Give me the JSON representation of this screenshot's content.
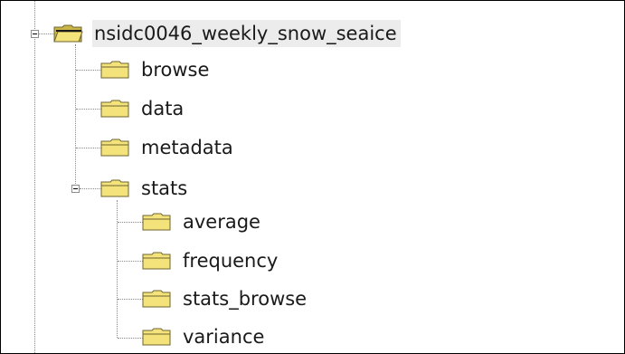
{
  "tree": {
    "root": {
      "label": "nsidc0046_weekly_snow_seaice",
      "icon": "folder-open-icon",
      "expanded": true,
      "selected": true,
      "children": [
        {
          "label": "browse",
          "icon": "folder-icon"
        },
        {
          "label": "data",
          "icon": "folder-icon"
        },
        {
          "label": "metadata",
          "icon": "folder-icon"
        },
        {
          "label": "stats",
          "icon": "folder-icon",
          "expanded": true,
          "children": [
            {
              "label": "average",
              "icon": "folder-icon"
            },
            {
              "label": "frequency",
              "icon": "folder-icon"
            },
            {
              "label": "stats_browse",
              "icon": "folder-icon"
            },
            {
              "label": "variance",
              "icon": "folder-icon"
            }
          ]
        }
      ]
    }
  },
  "colors": {
    "folder_fill": "#f4e27a",
    "folder_edge": "#6e6430",
    "selection": "#ececec",
    "connector": "#8a8a8a"
  }
}
